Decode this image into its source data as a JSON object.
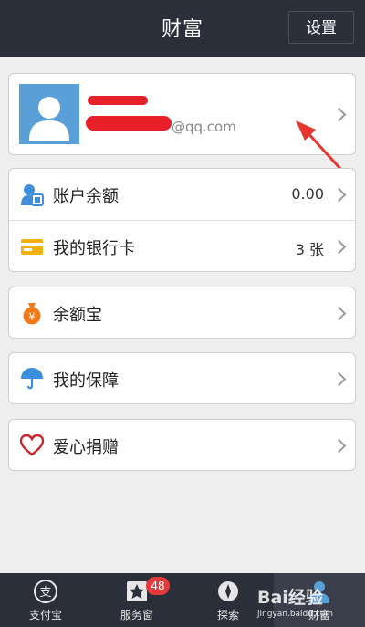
{
  "header": {
    "title": "财富",
    "settings_label": "设置"
  },
  "profile": {
    "email_suffix": "@qq.com"
  },
  "account_group": [
    {
      "label": "账户余额",
      "value": "0.00"
    },
    {
      "label": "我的银行卡",
      "value": "3 张"
    }
  ],
  "menu": {
    "yuebao": "余额宝",
    "insurance": "我的保障",
    "donation": "爱心捐赠"
  },
  "tabbar": [
    {
      "label": "支付宝"
    },
    {
      "label": "服务窗",
      "badge": "48"
    },
    {
      "label": "探索"
    },
    {
      "label": "财富"
    }
  ],
  "watermark": {
    "text": "Bai经验",
    "url": "jingyan.baidu.com"
  },
  "colors": {
    "header_bg": "#2b2f3a",
    "avatar_bg": "#5aa0d8",
    "redaction": "#e8202a",
    "annotation_arrow": "#e8362f",
    "badge": "#e33b3b"
  }
}
